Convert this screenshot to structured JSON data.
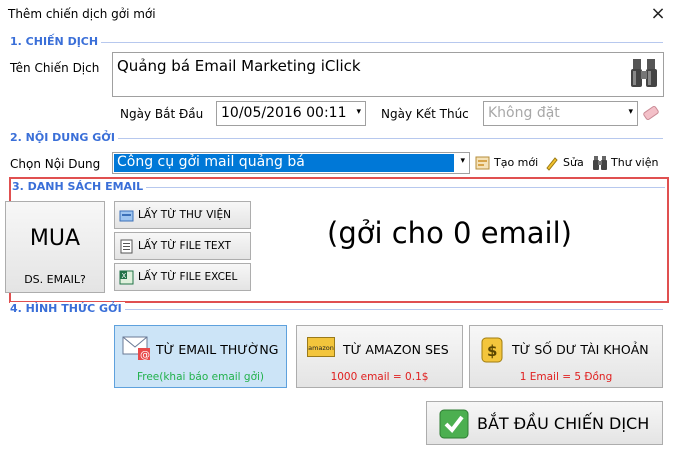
{
  "window": {
    "title": "Thêm chiến dịch gởi mới",
    "close_icon": "×"
  },
  "section1": {
    "heading": "1. CHIẾN DỊCH",
    "name_label": "Tên Chiến Dịch",
    "name_value": "Quảng bá Email Marketing iClick",
    "start_label": "Ngày Bắt Đầu",
    "start_value": "10/05/2016  00:11",
    "end_label": "Ngày Kết Thúc",
    "end_value": "Không đặt"
  },
  "section2": {
    "heading": "2. NỘI DUNG GỞI",
    "content_label": "Chọn Nội Dung",
    "content_value": "Công cụ gởi mail quảng bá",
    "new_label": "Tạo mới",
    "edit_label": "Sửa",
    "library_label": "Thư viện"
  },
  "section3": {
    "heading": "3. DANH SÁCH EMAIL",
    "buy_main": "MUA",
    "buy_sub": "DS. EMAIL?",
    "from_library": "LẤY TỪ THƯ VIỆN",
    "from_text": "LẤY TỪ FILE TEXT",
    "from_excel": "LẤY TỪ FILE EXCEL",
    "send_count": "(gởi cho 0 email)"
  },
  "section4": {
    "heading": "4. HÌNH THỨC GỞI",
    "normal_label": "TỪ EMAIL THƯỜNG",
    "normal_note": "Free(khai báo email gởi)",
    "amazon_label": "TỪ AMAZON SES",
    "amazon_note": "1000 email = 0.1$",
    "amazon_icon_text": "amazon",
    "balance_label": "TỪ SỐ DƯ TÀI KHOẢN",
    "balance_note": "1 Email = 5 Đồng",
    "start_button": "BẮT ĐẦU CHIẾN DỊCH"
  },
  "colors": {
    "section_heading": "#3a6fd8",
    "highlight_frame": "#e05050",
    "selected_blue": "#0078d7",
    "free_green": "#22b14c",
    "price_red": "#e02020"
  }
}
